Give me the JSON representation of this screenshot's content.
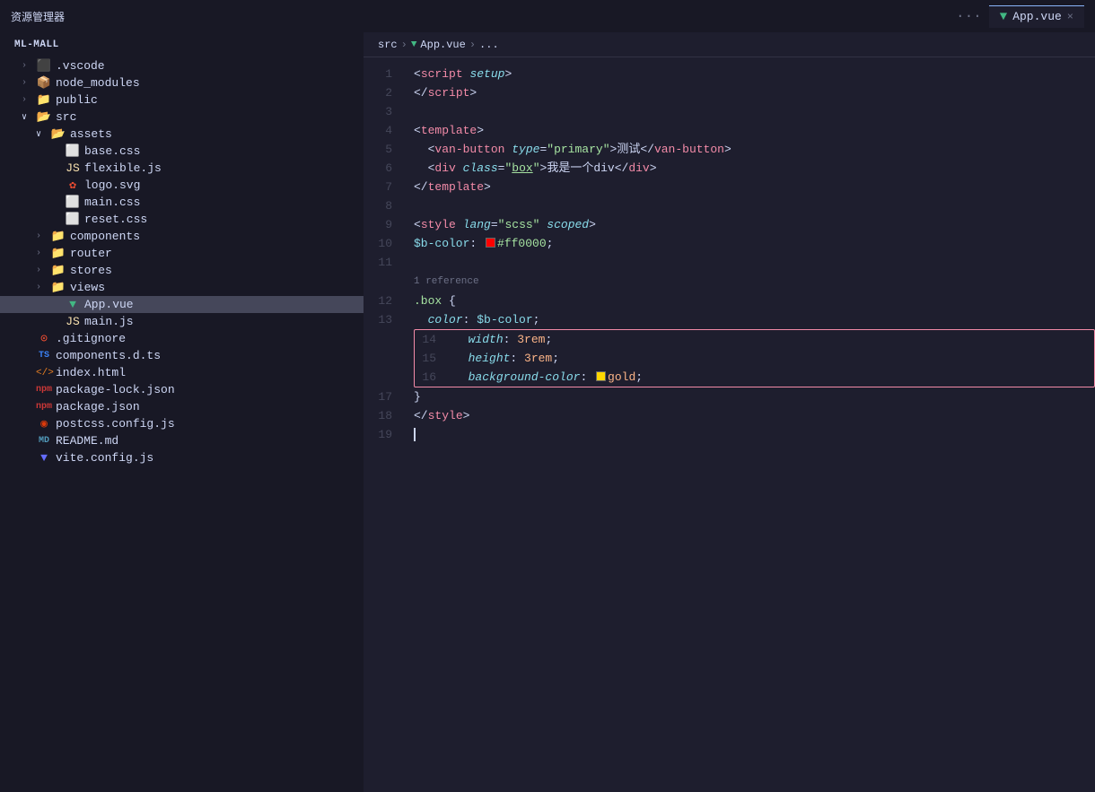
{
  "topbar": {
    "title": "资源管理器",
    "dots": "···",
    "tab": {
      "label": "App.vue",
      "close": "×"
    }
  },
  "breadcrumb": {
    "src": "src",
    "sep1": ">",
    "file": "App.vue",
    "sep2": ">",
    "dots": "..."
  },
  "sidebar": {
    "header": "ML-MALL",
    "items": [
      {
        "id": "vscode",
        "indent": "indent-1",
        "arrow": "›",
        "expanded": false,
        "icon": "vscode",
        "label": ".vscode"
      },
      {
        "id": "node_modules",
        "indent": "indent-1",
        "arrow": "›",
        "expanded": false,
        "icon": "npm-folder",
        "label": "node_modules"
      },
      {
        "id": "public",
        "indent": "indent-1",
        "arrow": "›",
        "expanded": false,
        "icon": "folder-blue",
        "label": "public"
      },
      {
        "id": "src",
        "indent": "indent-1",
        "arrow": "∨",
        "expanded": true,
        "icon": "folder-blue",
        "label": "src"
      },
      {
        "id": "assets",
        "indent": "indent-2",
        "arrow": "∨",
        "expanded": true,
        "icon": "folder-blue",
        "label": "assets"
      },
      {
        "id": "base-css",
        "indent": "indent-3",
        "arrow": "",
        "icon": "css",
        "label": "base.css"
      },
      {
        "id": "flexible-js",
        "indent": "indent-3",
        "arrow": "",
        "icon": "js",
        "label": "flexible.js"
      },
      {
        "id": "logo-svg",
        "indent": "indent-3",
        "arrow": "",
        "icon": "git-icon",
        "label": "logo.svg"
      },
      {
        "id": "main-css",
        "indent": "indent-3",
        "arrow": "",
        "icon": "css",
        "label": "main.css"
      },
      {
        "id": "reset-css",
        "indent": "indent-3",
        "arrow": "",
        "icon": "css",
        "label": "reset.css"
      },
      {
        "id": "components",
        "indent": "indent-2",
        "arrow": "›",
        "expanded": false,
        "icon": "folder-blue",
        "label": "components"
      },
      {
        "id": "router",
        "indent": "indent-2",
        "arrow": "›",
        "expanded": false,
        "icon": "folder-blue",
        "label": "router"
      },
      {
        "id": "stores",
        "indent": "indent-2",
        "arrow": "›",
        "expanded": false,
        "icon": "folder-blue",
        "label": "stores"
      },
      {
        "id": "views",
        "indent": "indent-2",
        "arrow": "›",
        "expanded": false,
        "icon": "folder-blue",
        "label": "views"
      },
      {
        "id": "app-vue",
        "indent": "indent-3",
        "arrow": "",
        "icon": "vue",
        "label": "App.vue",
        "active": true
      },
      {
        "id": "main-js",
        "indent": "indent-3",
        "arrow": "",
        "icon": "js",
        "label": "main.js"
      },
      {
        "id": "gitignore",
        "indent": "indent-1",
        "arrow": "",
        "icon": "git-icon-red",
        "label": ".gitignore"
      },
      {
        "id": "components-d-ts",
        "indent": "indent-1",
        "arrow": "",
        "icon": "ts",
        "label": "components.d.ts"
      },
      {
        "id": "index-html",
        "indent": "indent-1",
        "arrow": "",
        "icon": "html",
        "label": "index.html"
      },
      {
        "id": "package-lock-json",
        "indent": "indent-1",
        "arrow": "",
        "icon": "npm",
        "label": "package-lock.json"
      },
      {
        "id": "package-json",
        "indent": "indent-1",
        "arrow": "",
        "icon": "npm",
        "label": "package.json"
      },
      {
        "id": "postcss-config-js",
        "indent": "indent-1",
        "arrow": "",
        "icon": "postcss",
        "label": "postcss.config.js"
      },
      {
        "id": "readme-md",
        "indent": "indent-1",
        "arrow": "",
        "icon": "md",
        "label": "README.md"
      },
      {
        "id": "vite-config-js",
        "indent": "indent-1",
        "arrow": "",
        "icon": "vite",
        "label": "vite.config.js"
      }
    ]
  },
  "code": {
    "reference_text": "1 reference",
    "lines": [
      {
        "num": "1",
        "type": "script-open"
      },
      {
        "num": "2",
        "type": "script-close"
      },
      {
        "num": "3",
        "type": "empty"
      },
      {
        "num": "4",
        "type": "template-open"
      },
      {
        "num": "5",
        "type": "van-button"
      },
      {
        "num": "6",
        "type": "div-line"
      },
      {
        "num": "7",
        "type": "template-close"
      },
      {
        "num": "8",
        "type": "empty"
      },
      {
        "num": "9",
        "type": "style-open"
      },
      {
        "num": "10",
        "type": "scss-var"
      },
      {
        "num": "11",
        "type": "empty"
      },
      {
        "num": "reference",
        "type": "reference"
      },
      {
        "num": "12",
        "type": "box-selector"
      },
      {
        "num": "13",
        "type": "color-prop"
      },
      {
        "num": "14",
        "type": "width-prop",
        "highlighted": true
      },
      {
        "num": "15",
        "type": "height-prop",
        "highlighted": true
      },
      {
        "num": "16",
        "type": "bg-prop",
        "highlighted": true
      },
      {
        "num": "17",
        "type": "close-brace"
      },
      {
        "num": "18",
        "type": "style-close"
      },
      {
        "num": "19",
        "type": "cursor-line"
      }
    ]
  },
  "colors": {
    "bg": "#1e1e2e",
    "sidebar_bg": "#181825",
    "active_item": "#45475a",
    "border": "#313244",
    "accent": "#89b4fa",
    "red": "#f38ba8"
  }
}
